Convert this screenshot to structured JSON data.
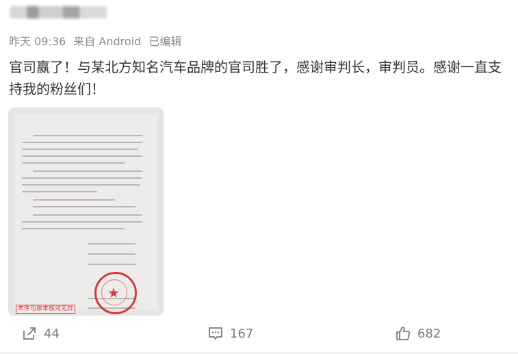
{
  "post": {
    "time": "昨天 09:36",
    "source": "来自 Android",
    "edited": "已编辑",
    "text": "官司赢了！与某北方知名汽车品牌的官司胜了，感谢审判长，审判员。感谢一直支持我的粉丝们！",
    "image_stamp_text": "本件与原本核对无异"
  },
  "actions": {
    "repost_count": "44",
    "comment_count": "167",
    "like_count": "682"
  },
  "icons": {
    "repost": "share-arrow-icon",
    "comment": "comment-bubble-icon",
    "like": "thumbs-up-icon"
  },
  "colors": {
    "seal": "#d23b3b",
    "meta": "#8a8a8a"
  }
}
